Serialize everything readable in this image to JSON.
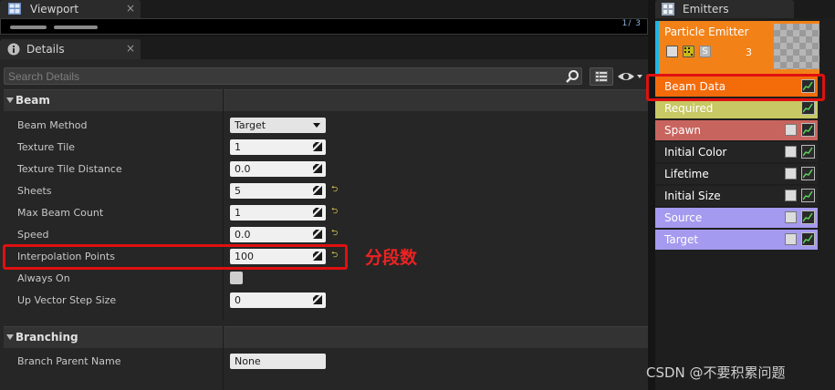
{
  "viewport": {
    "tab_label": "Viewport",
    "close_glyph": "×",
    "stats": "1/ 3"
  },
  "details": {
    "tab_label": "Details",
    "close_glyph": "×",
    "search": {
      "placeholder": "Search Details",
      "value": ""
    },
    "sections": [
      {
        "title": "Beam",
        "rows": [
          {
            "label": "Beam Method",
            "value": "Target",
            "kind": "select"
          },
          {
            "label": "Texture Tile",
            "value": "1",
            "kind": "number"
          },
          {
            "label": "Texture Tile Distance",
            "value": "0.0",
            "kind": "number"
          },
          {
            "label": "Sheets",
            "value": "5",
            "kind": "number",
            "modified": true
          },
          {
            "label": "Max Beam Count",
            "value": "1",
            "kind": "number",
            "modified": true
          },
          {
            "label": "Speed",
            "value": "0.0",
            "kind": "number",
            "modified": true
          },
          {
            "label": "Interpolation Points",
            "value": "100",
            "kind": "number",
            "modified": true
          },
          {
            "label": "Always On",
            "value": "",
            "kind": "checkbox"
          },
          {
            "label": "Up Vector Step Size",
            "value": "0",
            "kind": "number"
          }
        ]
      },
      {
        "title": "Branching",
        "rows": [
          {
            "label": "Branch Parent Name",
            "value": "None",
            "kind": "text"
          }
        ]
      }
    ],
    "annotation": "分段数",
    "reset_glyph": "⮌"
  },
  "emitters": {
    "tab_label": "Emitters",
    "emitter": {
      "name": "Particle Emitter",
      "count": "3",
      "toggle_letter": "S"
    },
    "modules": [
      {
        "label": "Beam Data",
        "bg": "#f46b0a",
        "fg": "#ffffff",
        "has_checkbox": false
      },
      {
        "label": "Required",
        "bg": "#c8c864",
        "fg": "#ffffff",
        "has_checkbox": false
      },
      {
        "label": "Spawn",
        "bg": "#c8645e",
        "fg": "#ffffff",
        "has_checkbox": true
      },
      {
        "label": "Initial Color",
        "bg": "#242424",
        "fg": "#ffffff",
        "has_checkbox": true
      },
      {
        "label": "Lifetime",
        "bg": "#242424",
        "fg": "#ffffff",
        "has_checkbox": true
      },
      {
        "label": "Initial Size",
        "bg": "#242424",
        "fg": "#ffffff",
        "has_checkbox": true
      },
      {
        "label": "Source",
        "bg": "#a49af0",
        "fg": "#ffffff",
        "has_checkbox": true
      },
      {
        "label": "Target",
        "bg": "#a49af0",
        "fg": "#ffffff",
        "has_checkbox": true
      }
    ]
  },
  "watermark": "CSDN @不要积累问题",
  "colors": {
    "highlight": "#e01010",
    "emitter_header": "#f28218",
    "emitter_accent": "#19b6e8"
  }
}
